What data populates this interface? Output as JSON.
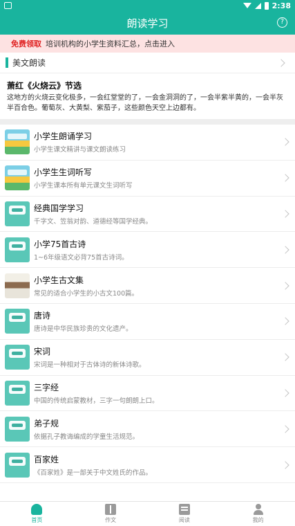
{
  "status_bar": {
    "time": "2:38"
  },
  "app_bar": {
    "title": "朗读学习"
  },
  "promo": {
    "tag": "免费领取",
    "text": "培训机构的小学生资料汇总，点击进入"
  },
  "section": {
    "title": "美文朗读"
  },
  "excerpt": {
    "title": "萧红《火烧云》节选",
    "body": "这地方的火烧云变化极多，一会红堂堂的了，一会金洞洞的了，一会半紫半黄的，一会半灰半百合色。葡萄灰、大黄梨、紫茄子，这些颜色天空上边都有。"
  },
  "items": [
    {
      "title": "小学生朗诵学习",
      "desc": "小学生课文精讲与课文朗读练习",
      "thumb": "thumb-a"
    },
    {
      "title": "小学生生词听写",
      "desc": "小学生课本所有单元课文生词听写",
      "thumb": "thumb-a"
    },
    {
      "title": "经典国学学习",
      "desc": "千字文、笠翁对韵、道德经等国学经典。",
      "thumb": "thumb-b"
    },
    {
      "title": "小学75首古诗",
      "desc": "1~6年级语文必背75首古诗词。",
      "thumb": "thumb-b"
    },
    {
      "title": "小学生古文集",
      "desc": "常见的适合小学生的小古文100篇。",
      "thumb": "thumb-c"
    },
    {
      "title": "唐诗",
      "desc": "唐诗是中华民族珍贵的文化遗产。",
      "thumb": "thumb-b"
    },
    {
      "title": "宋词",
      "desc": "宋词是一种相对于古体诗的新体诗歌。",
      "thumb": "thumb-b"
    },
    {
      "title": "三字经",
      "desc": "中国的传统启蒙教材，三字一句朗朗上口。",
      "thumb": "thumb-b"
    },
    {
      "title": "弟子规",
      "desc": "依据孔子教诲编成的学童生活规范。",
      "thumb": "thumb-b"
    },
    {
      "title": "百家姓",
      "desc": "《百家姓》是一部关于中文姓氏的作品。",
      "thumb": "thumb-b"
    }
  ],
  "tabs": [
    {
      "label": "首页",
      "icon": "home-icon"
    },
    {
      "label": "作文",
      "icon": "book-icon"
    },
    {
      "label": "阅读",
      "icon": "read-icon"
    },
    {
      "label": "我的",
      "icon": "user-icon"
    }
  ],
  "colors": {
    "accent": "#19b49e",
    "promo_bg": "#fde2e2",
    "promo_tag": "#e02424"
  }
}
